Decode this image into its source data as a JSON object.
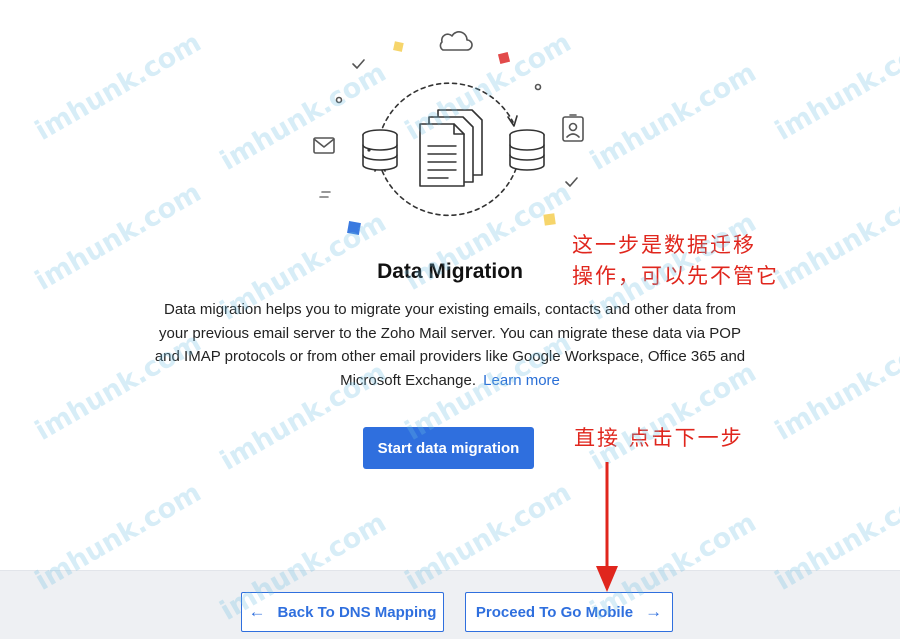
{
  "main": {
    "title": "Data Migration",
    "description": "Data migration helps you to migrate your existing emails, contacts and other data from your previous email server to the Zoho Mail server. You can migrate these data via POP and IMAP protocols or from other email providers like Google Workspace, Office 365 and Microsoft Exchange.",
    "learn_more": "Learn more",
    "start_button": "Start data migration"
  },
  "annotations": {
    "line1": "这一步是数据迁移",
    "line2": "操作，可以先不管它",
    "line3": "直接 点击下一步"
  },
  "footer": {
    "back_label": "Back To DNS Mapping",
    "back_icon": "←",
    "next_label": "Proceed To Go Mobile",
    "next_icon": "→"
  },
  "watermark": {
    "text": "imhunk.com"
  },
  "colors": {
    "accent": "#2f6fde",
    "annotation": "#e0261d",
    "footer_bg": "#eef0f3"
  },
  "icons": [
    "cloud-icon",
    "database-icon",
    "documents-icon",
    "mail-icon",
    "id-badge-icon",
    "check-icon",
    "sync-arrows-icon",
    "arrow-left-icon",
    "arrow-right-icon"
  ]
}
